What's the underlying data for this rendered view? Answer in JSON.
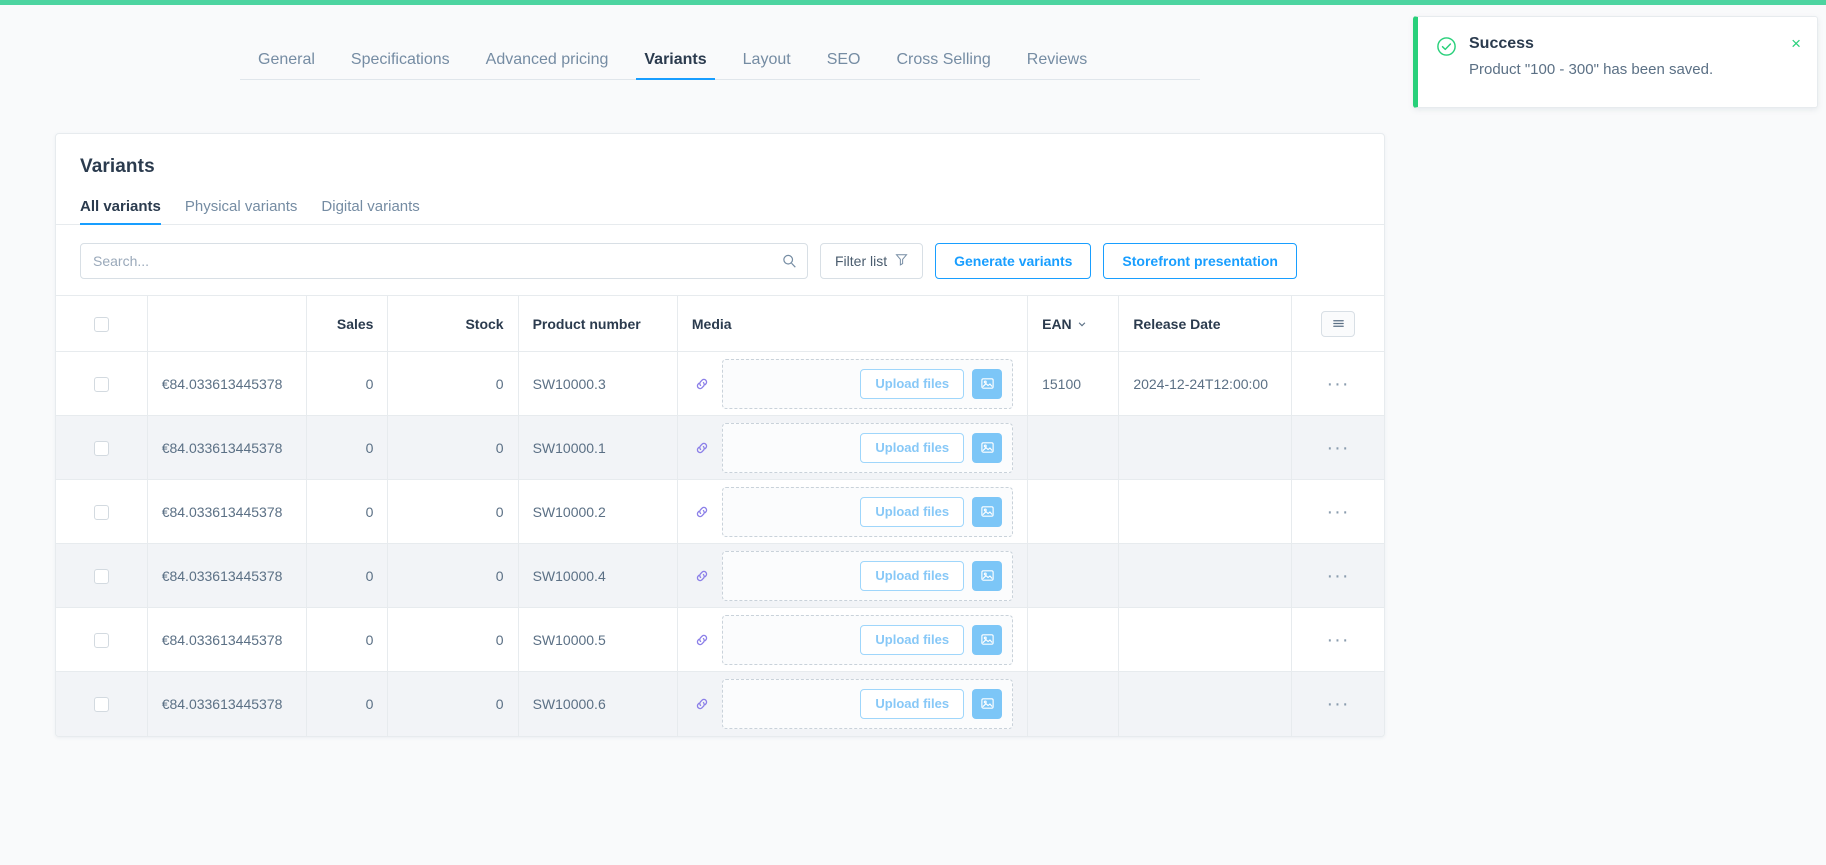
{
  "theme": {
    "accent": "#189eff",
    "success": "#28d07a",
    "progress_bar": "#4dd4a0",
    "text_dark": "#2b3b4e",
    "text_muted": "#758ca3",
    "link_icon": "#8b7fe8",
    "upload_blue": "#7cc6f7",
    "page_bg": "#f9fafb"
  },
  "tabs": [
    {
      "label": "General",
      "active": false
    },
    {
      "label": "Specifications",
      "active": false
    },
    {
      "label": "Advanced pricing",
      "active": false
    },
    {
      "label": "Variants",
      "active": true
    },
    {
      "label": "Layout",
      "active": false
    },
    {
      "label": "SEO",
      "active": false
    },
    {
      "label": "Cross Selling",
      "active": false
    },
    {
      "label": "Reviews",
      "active": false
    }
  ],
  "card": {
    "title": "Variants",
    "subtabs": [
      {
        "label": "All variants",
        "active": true
      },
      {
        "label": "Physical variants",
        "active": false
      },
      {
        "label": "Digital variants",
        "active": false
      }
    ]
  },
  "toolbar": {
    "search_value": "",
    "search_placeholder": "Search...",
    "search_icon": "search-icon",
    "filter_label": "Filter list",
    "filter_icon": "funnel-icon",
    "generate_label": "Generate variants",
    "storefront_label": "Storefront presentation"
  },
  "table": {
    "columns": [
      {
        "key": "check",
        "label": "",
        "icon": "checkbox-icon"
      },
      {
        "key": "price",
        "label": ""
      },
      {
        "key": "sales",
        "label": "Sales"
      },
      {
        "key": "stock",
        "label": "Stock"
      },
      {
        "key": "pnum",
        "label": "Product number"
      },
      {
        "key": "media",
        "label": "Media"
      },
      {
        "key": "ean",
        "label": "EAN",
        "sortable": true,
        "sort_icon": "chevron-down-icon"
      },
      {
        "key": "date",
        "label": "Release Date"
      },
      {
        "key": "actions",
        "label": "",
        "icon": "columns-menu-icon"
      }
    ],
    "media_labels": {
      "link_icon": "link-icon",
      "upload_label": "Upload files",
      "image_button_icon": "image-icon"
    },
    "row_action_icon": "ellipsis-icon",
    "rows": [
      {
        "price": "€84.033613445378",
        "sales": "0",
        "stock": "0",
        "product_number": "SW10000.3",
        "ean": "15100",
        "release_date": "2024-12-24T12:00:00"
      },
      {
        "price": "€84.033613445378",
        "sales": "0",
        "stock": "0",
        "product_number": "SW10000.1",
        "ean": "",
        "release_date": ""
      },
      {
        "price": "€84.033613445378",
        "sales": "0",
        "stock": "0",
        "product_number": "SW10000.2",
        "ean": "",
        "release_date": ""
      },
      {
        "price": "€84.033613445378",
        "sales": "0",
        "stock": "0",
        "product_number": "SW10000.4",
        "ean": "",
        "release_date": ""
      },
      {
        "price": "€84.033613445378",
        "sales": "0",
        "stock": "0",
        "product_number": "SW10000.5",
        "ean": "",
        "release_date": ""
      },
      {
        "price": "€84.033613445378",
        "sales": "0",
        "stock": "0",
        "product_number": "SW10000.6",
        "ean": "",
        "release_date": ""
      }
    ]
  },
  "toast": {
    "icon": "check-circle-icon",
    "title": "Success",
    "message": "Product \"100 - 300\" has been saved.",
    "close_label": "×"
  }
}
